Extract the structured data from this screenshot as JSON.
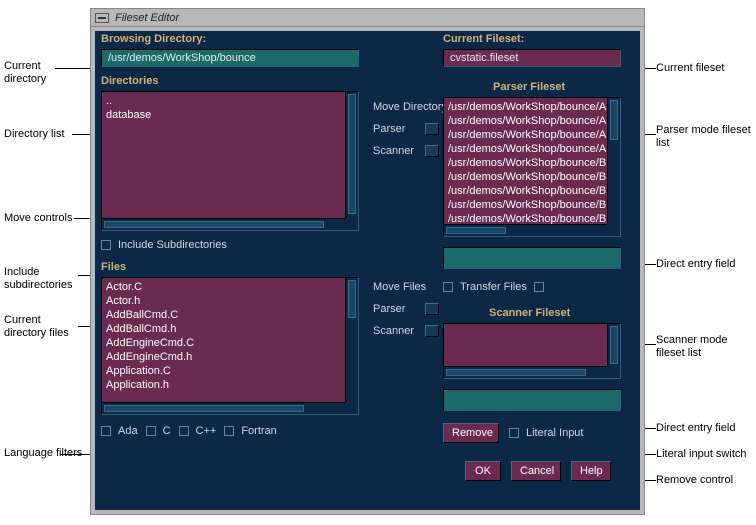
{
  "window": {
    "title": "Fileset Editor"
  },
  "browsing": {
    "label": "Browsing Directory:",
    "path": "/usr/demos/WorkShop/bounce"
  },
  "directories": {
    "label": "Directories",
    "items": [
      "..",
      "database"
    ]
  },
  "include_sub": {
    "label": "Include Subdirectories"
  },
  "files": {
    "label": "Files",
    "items": [
      "Actor.C",
      "Actor.h",
      "AddBallCmd.C",
      "AddBallCmd.h",
      "AddEngineCmd.C",
      "AddEngineCmd.h",
      "Application.C",
      "Application.h"
    ]
  },
  "lang": {
    "ada": "Ada",
    "c": "C",
    "cpp": "C++",
    "fortran": "Fortran"
  },
  "move_dir": {
    "label": "Move Directory",
    "parser": "Parser",
    "scanner": "Scanner"
  },
  "move_files": {
    "label": "Move Files",
    "parser": "Parser",
    "scanner": "Scanner"
  },
  "current_fileset": {
    "label": "Current Fileset:",
    "value": "cvstatic.fileset"
  },
  "parser_fileset": {
    "label": "Parser Fileset",
    "items": [
      "/usr/demos/WorkShop/bounce/Actor.C",
      "/usr/demos/WorkShop/bounce/AddBall",
      "/usr/demos/WorkShop/bounce/Applicat",
      "/usr/demos/WorkShop/bounce/AskFirst",
      "/usr/demos/WorkShop/bounce/BasicCo",
      "/usr/demos/WorkShop/bounce/Bounce",
      "/usr/demos/WorkShop/bounce/Bounce",
      "/usr/demos/WorkShop/bounce/Bounce",
      "/usr/demos/WorkShop/bounce/BoundIn"
    ]
  },
  "transfer_files": {
    "label": "Transfer Files"
  },
  "scanner_fileset": {
    "label": "Scanner Fileset"
  },
  "remove": "Remove",
  "literal_input": "Literal Input",
  "ok": "OK",
  "cancel": "Cancel",
  "help": "Help",
  "callouts": {
    "cur_dir": "Current directory",
    "dir_list": "Directory list",
    "move_controls": "Move controls",
    "include_sub": "Include subdirectories",
    "cur_files": "Current directory files",
    "lang_filters": "Language filters",
    "cur_fileset": "Current fileset",
    "parser_list": "Parser mode fileset list",
    "direct_entry": "Direct entry field",
    "scanner_list": "Scanner mode fileset list",
    "direct_entry2": "Direct entry field",
    "literal_sw": "Literal input switch",
    "remove_ctrl": "Remove control"
  }
}
